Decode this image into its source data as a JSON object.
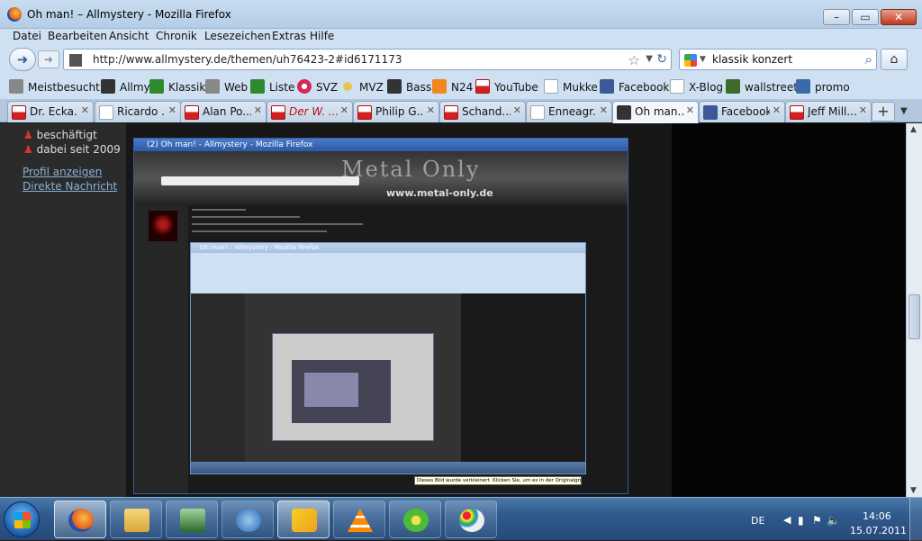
{
  "window": {
    "title": "Oh man! – Allmystery - Mozilla Firefox"
  },
  "menu": [
    "Datei",
    "Bearbeiten",
    "Ansicht",
    "Chronik",
    "Lesezeichen",
    "Extras",
    "Hilfe"
  ],
  "nav": {
    "url": "http://www.allmystery.de/themen/uh76423-2#id6171173",
    "search_value": "klassik konzert"
  },
  "bookmarks": [
    {
      "label": "Meistbesucht",
      "icon": "bookmark-star-icon"
    },
    {
      "label": "Allmy",
      "icon": "allmy-icon"
    },
    {
      "label": "Klassik",
      "icon": "klassik-icon"
    },
    {
      "label": "Web",
      "icon": "web-icon"
    },
    {
      "label": "Liste",
      "icon": "liste-icon"
    },
    {
      "label": "SVZ",
      "icon": "gear-icon"
    },
    {
      "label": "MVZ",
      "icon": "sun-icon"
    },
    {
      "label": "Bass",
      "icon": "bass-icon"
    },
    {
      "label": "N24",
      "icon": "n24-icon"
    },
    {
      "label": "YouTube",
      "icon": "youtube-icon"
    },
    {
      "label": "Mukke",
      "icon": "page-icon"
    },
    {
      "label": "Facebook",
      "icon": "facebook-icon"
    },
    {
      "label": "X-Blog",
      "icon": "page-icon"
    },
    {
      "label": "wallstreet",
      "icon": "mo-icon"
    },
    {
      "label": "promo",
      "icon": "pb-icon"
    }
  ],
  "tabs": [
    {
      "label": "Dr. Ecka...",
      "icon": "youtube-icon"
    },
    {
      "label": "Ricardo ...",
      "icon": "page-icon"
    },
    {
      "label": "Alan Po...",
      "icon": "youtube-icon"
    },
    {
      "label": "Der W. ...",
      "icon": "youtube-icon"
    },
    {
      "label": "Philip G...",
      "icon": "youtube-icon"
    },
    {
      "label": "Schand...",
      "icon": "youtube-icon"
    },
    {
      "label": "Enneagr...",
      "icon": "page-icon"
    },
    {
      "label": "Oh man...",
      "icon": "allmy-icon"
    },
    {
      "label": "Facebook",
      "icon": "facebook-icon"
    },
    {
      "label": "Jeff Mill...",
      "icon": "youtube-icon"
    }
  ],
  "profile": {
    "status": "beschäftigt",
    "since": "dabei seit 2009",
    "profile_link": "Profil anzeigen",
    "message_link": "Direkte Nachricht"
  },
  "nested": {
    "title1": "(2) Oh man! - Allmystery - Mozilla Firefox",
    "logo": "Metal Only",
    "site": "www.metal-only.de",
    "title2": "Oh man! – Allmystery - Mozilla Firefox",
    "tooltip": "Dieses Bild wurde verkleinert. Klicken Sie, um es in der Originalgröße anzuzeigen."
  },
  "taskbar": {
    "lang": "DE",
    "time": "14:06",
    "date": "15.07.2011"
  },
  "colors": {
    "link": "#8ab0d8",
    "accent": "#2f5a8e"
  }
}
